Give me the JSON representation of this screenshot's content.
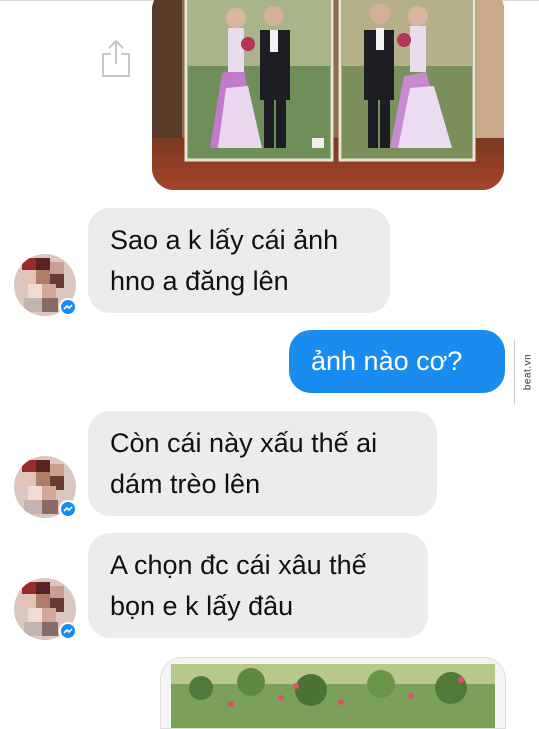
{
  "messages": [
    {
      "direction": "incoming",
      "lines": [
        "Sao a k lấy cái ảnh",
        "hno a đăng lên"
      ]
    },
    {
      "direction": "outgoing",
      "lines": [
        "ảnh nào cơ?"
      ]
    },
    {
      "direction": "incoming",
      "lines": [
        "Còn cái này xấu thế ai",
        "dám trèo lên"
      ]
    },
    {
      "direction": "incoming",
      "lines": [
        "A chọn đc cái xâu thế",
        "bọn e k lấy đâu"
      ]
    }
  ],
  "watermark": {
    "text": "beat.vn"
  },
  "icons": {
    "share": "share-icon",
    "verified": "messenger-badge-icon"
  },
  "colors": {
    "outgoing_bubble": "#1a8cf0",
    "incoming_bubble": "#ececec",
    "text": "#111111"
  }
}
